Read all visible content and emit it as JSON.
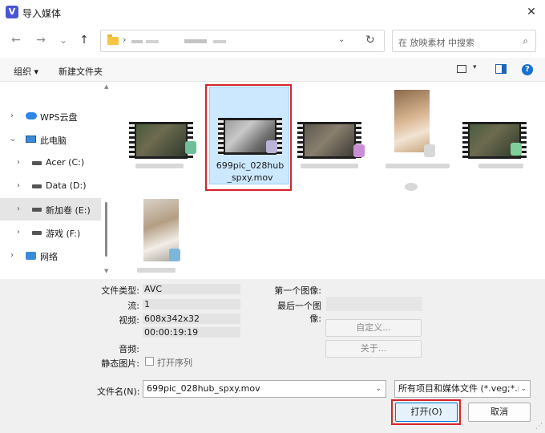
{
  "window": {
    "title": "导入媒体",
    "logo_letter": "V",
    "close": "✕"
  },
  "nav": {
    "back": "←",
    "forward": "→",
    "history": "⌄",
    "up": "↑",
    "path_chevron": "›",
    "path_dropdown": "⌄",
    "refresh": "↻"
  },
  "search": {
    "placeholder": "在 放映素材 中搜索",
    "icon": "⌕"
  },
  "toolbar": {
    "organize": "组织 ▾",
    "new_folder": "新建文件夹",
    "view_dropdown": "▾",
    "help": "?"
  },
  "sidebar": {
    "items": [
      {
        "chevron": "›",
        "label": "WPS云盘",
        "icon": "cloud-icon"
      },
      {
        "chevron": "⌄",
        "label": "此电脑",
        "icon": "computer-icon"
      },
      {
        "chevron": "›",
        "label": "Acer (C:)",
        "icon": "drive-icon"
      },
      {
        "chevron": "›",
        "label": "Data (D:)",
        "icon": "drive-icon"
      },
      {
        "chevron": "›",
        "label": "新加卷 (E:)",
        "icon": "drive-icon",
        "selected": true
      },
      {
        "chevron": "›",
        "label": "游戏 (F:)",
        "icon": "drive-icon"
      },
      {
        "chevron": "›",
        "label": "网络",
        "icon": "network-icon"
      }
    ],
    "scroll_up": "▲",
    "scroll_down": "▼"
  },
  "files": {
    "selected_name": "699pic_028hub_spxy.mov",
    "selected_name_line1": "699pic_028hub",
    "selected_name_line2": "_spxy.mov"
  },
  "info": {
    "labels": {
      "file_type": "文件类型:",
      "stream": "流:",
      "video": "视频:",
      "audio": "音频:",
      "still": "静态图片:",
      "first_image": "第一个图像:",
      "last_image": "最后一个图像:"
    },
    "values": {
      "file_type": "AVC",
      "stream": "1",
      "video": "608x342x32",
      "duration": "00:00:19:19"
    },
    "customize_button": "自定义...",
    "about_button": "关于...",
    "open_sequence": "打开序列"
  },
  "footer": {
    "filename_label": "文件名(N):",
    "filename_value": "699pic_028hub_spxy.mov",
    "filetype_value": "所有项目和媒体文件 (*.veg;*.m",
    "dropdown": "⌄",
    "open_button": "打开(O)",
    "cancel_button": "取消",
    "resize_grip": "⋰"
  }
}
